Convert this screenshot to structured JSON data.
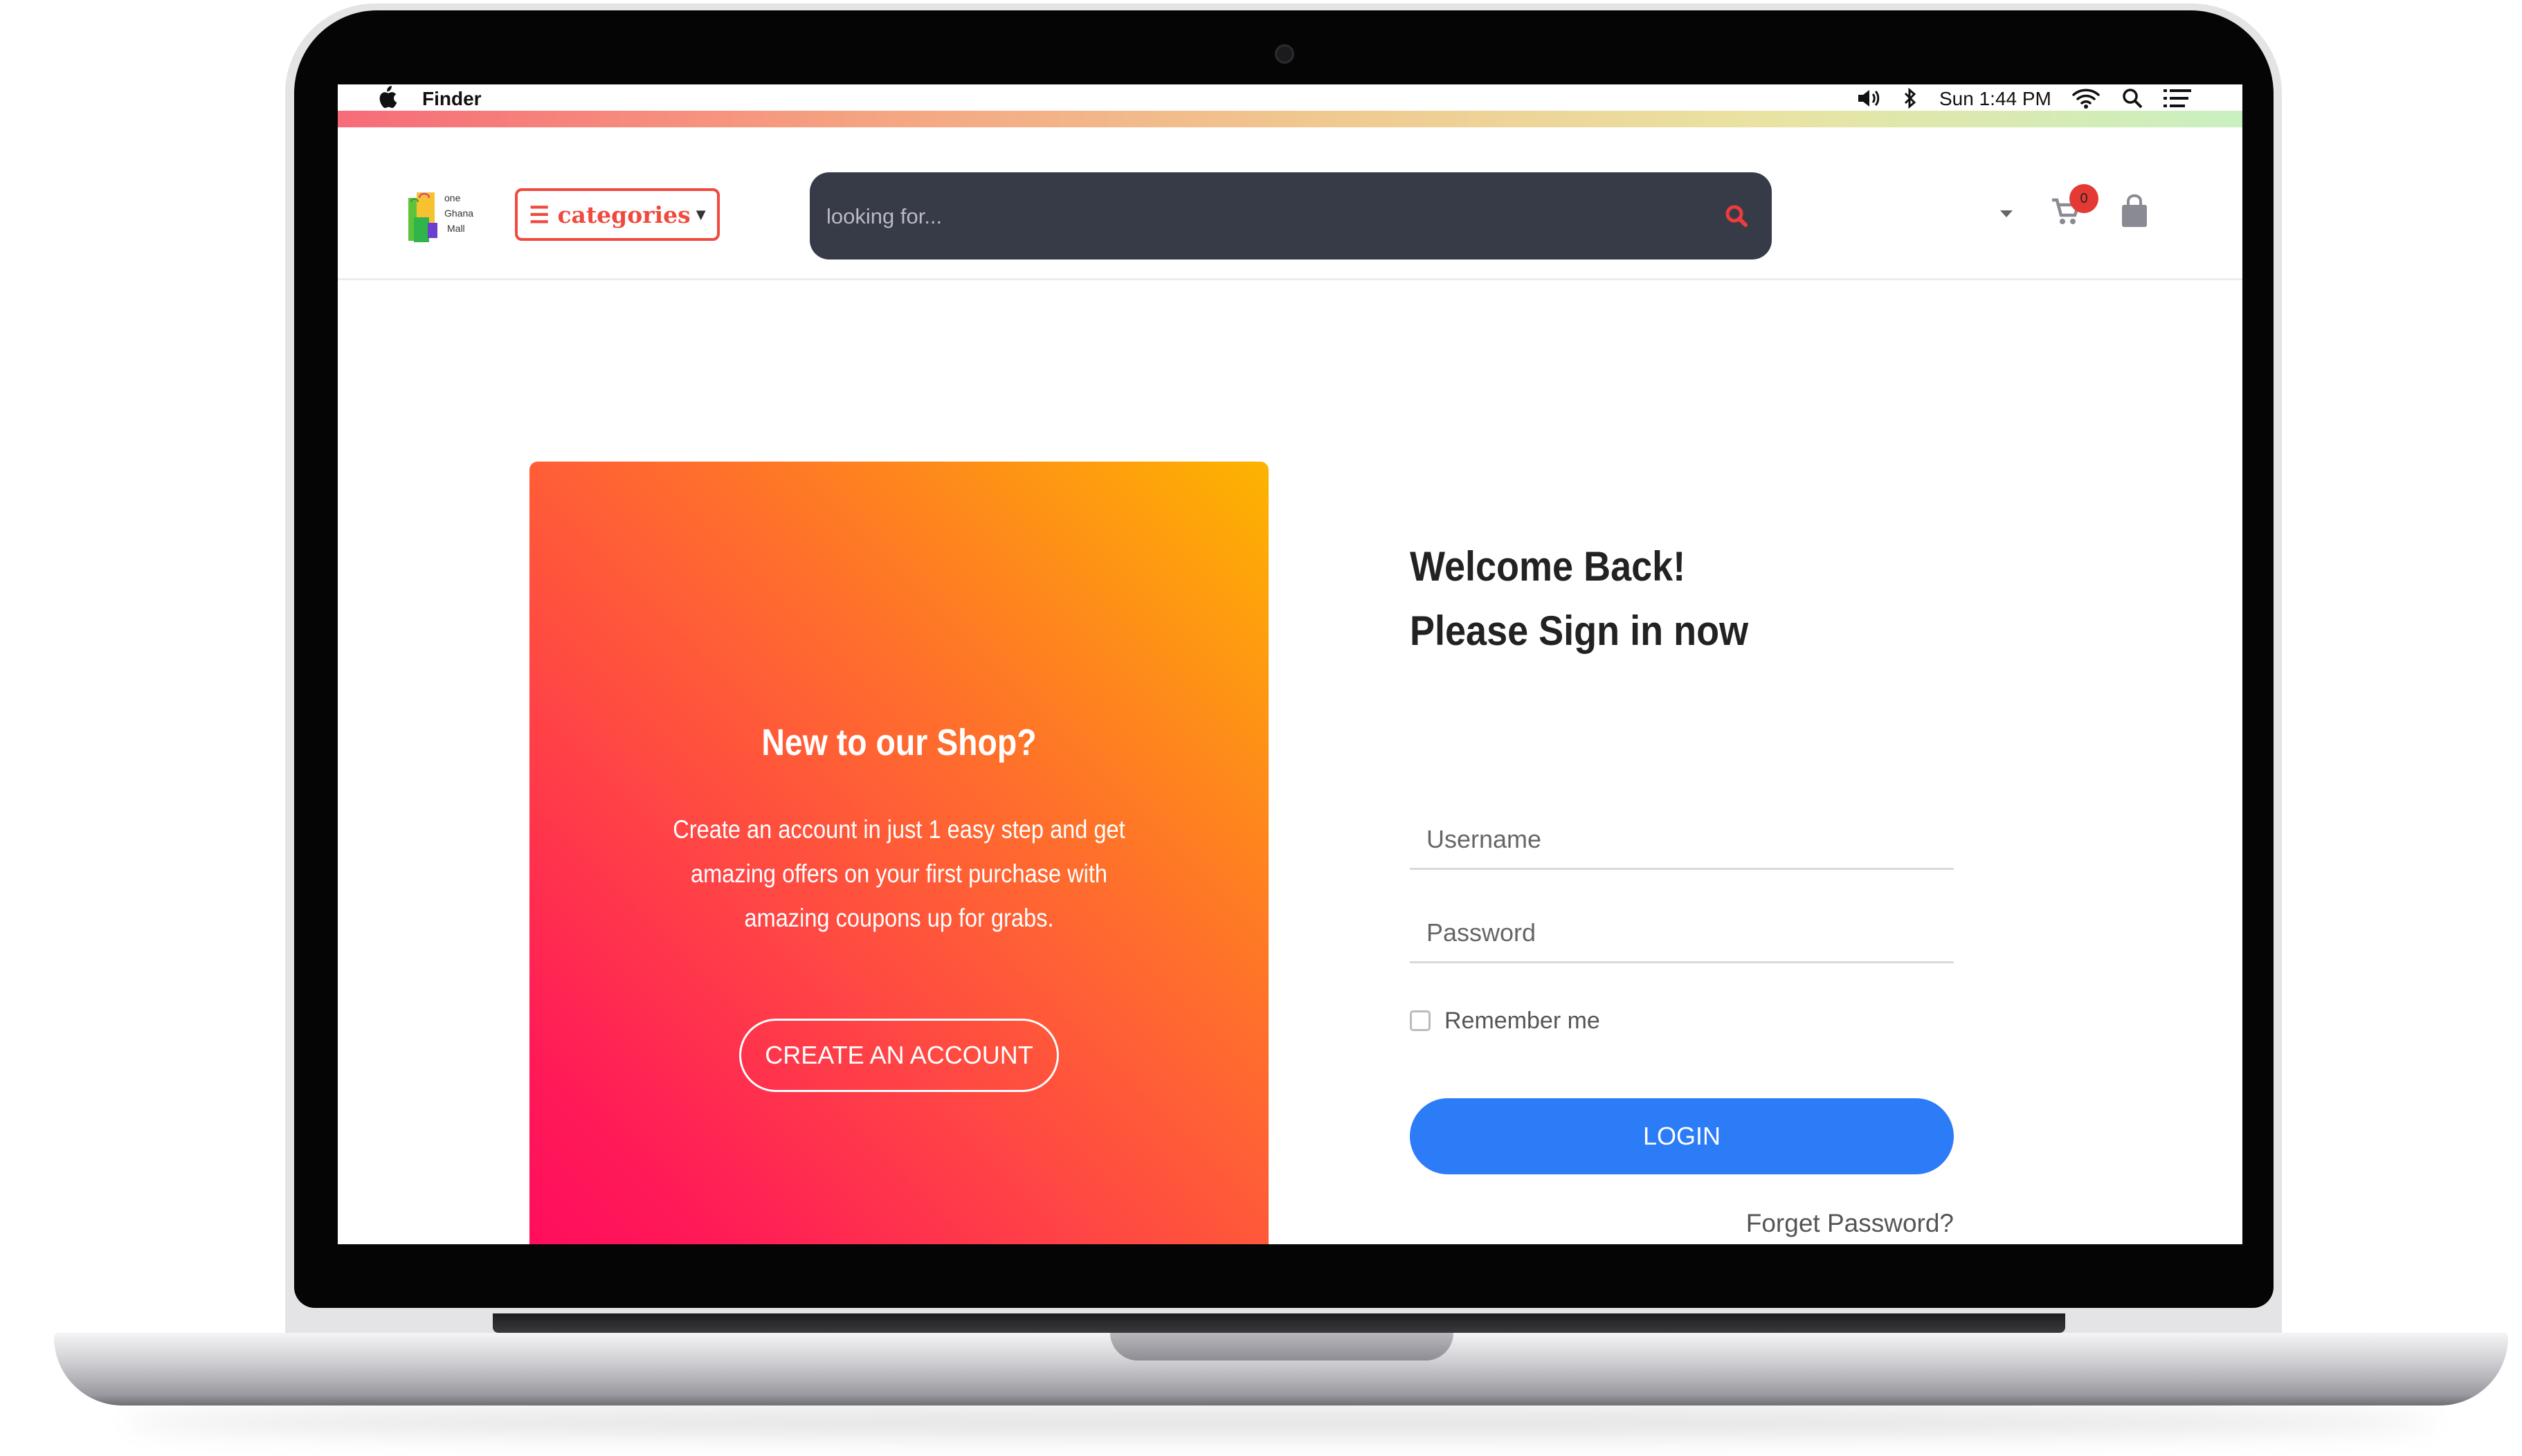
{
  "menubar": {
    "app_name": "Finder",
    "clock": "Sun 1:44 PM",
    "icons": [
      "apple-icon",
      "volume-icon",
      "bluetooth-icon",
      "wifi-icon",
      "spotlight-icon",
      "list-icon"
    ]
  },
  "header": {
    "logo_text": [
      "one",
      "Ghana",
      "Mall"
    ],
    "categories_label": "☰ categories",
    "search_placeholder": "looking for...",
    "cart_count": "0"
  },
  "promo": {
    "title": "New to our Shop?",
    "text": "Create an account in just 1 easy step and get amazing offers on your first purchase with amazing coupons up for grabs.",
    "button": "CREATE AN ACCOUNT"
  },
  "login": {
    "heading_line1": "Welcome Back!",
    "heading_line2": "Please Sign in now",
    "username_placeholder": "Username",
    "password_placeholder": "Password",
    "remember": "Remember me",
    "button": "LOGIN",
    "forget": "Forget Password?"
  },
  "colors": {
    "accent_red": "#ef4a3d",
    "login_blue": "#2c7cf7",
    "search_bg": "#373b48",
    "badge_red": "#e53935"
  }
}
